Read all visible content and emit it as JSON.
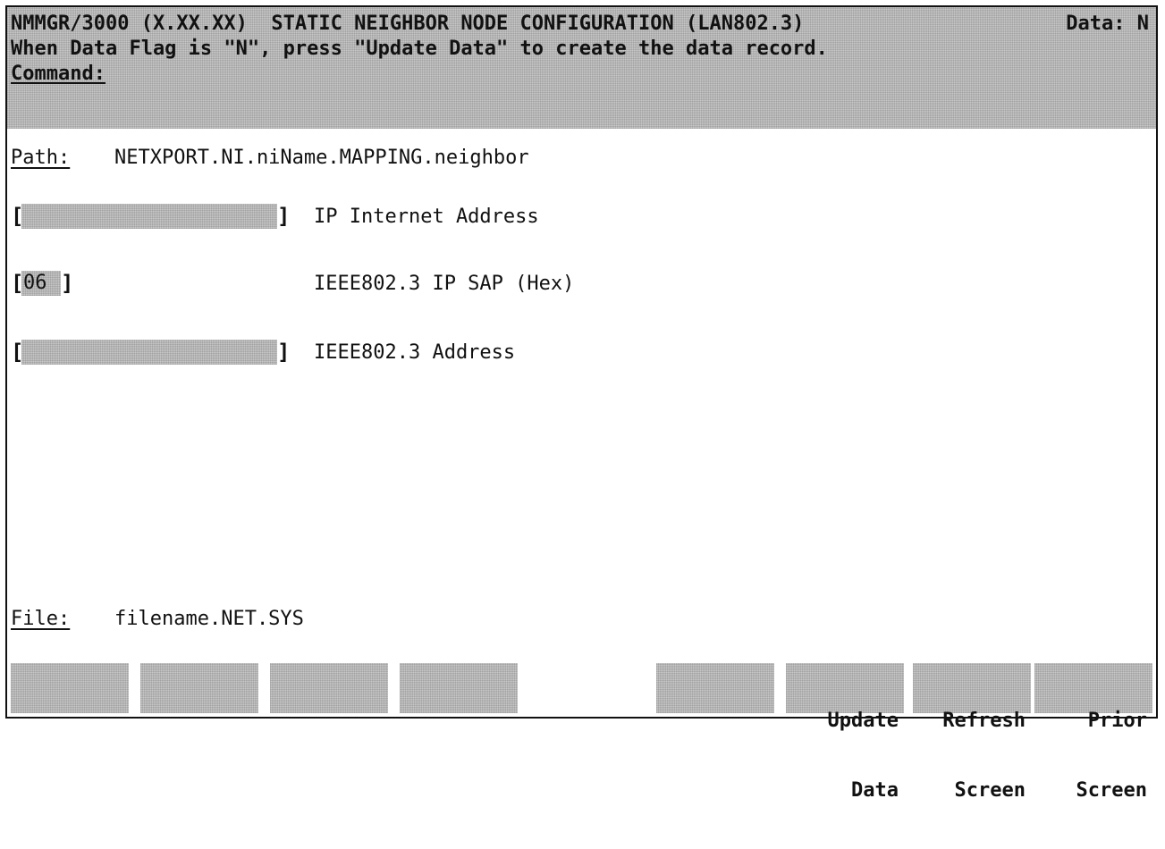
{
  "header": {
    "line1": "NMMGR/3000 (X.XX.XX)  STATIC NEIGHBOR NODE CONFIGURATION (LAN802.3)",
    "data_flag": "Data: N",
    "line2": "When Data Flag is \"N\", press \"Update Data\" to create the data record.",
    "command_label": "Command:"
  },
  "path": {
    "label": "Path:",
    "value": "NETXPORT.NI.niName.MAPPING.neighbor"
  },
  "fields": [
    {
      "value": "",
      "label": "IP Internet Address"
    },
    {
      "value": "06",
      "label": "IEEE802.3 IP SAP (Hex)"
    },
    {
      "value": "",
      "label": "IEEE802.3 Address"
    }
  ],
  "file": {
    "label": "File:",
    "value": "filename.NET.SYS"
  },
  "softkeys": [
    {
      "line1": "",
      "line2": ""
    },
    {
      "line1": "",
      "line2": ""
    },
    {
      "line1": "",
      "line2": ""
    },
    {
      "line1": "",
      "line2": ""
    },
    {
      "line1": "",
      "line2": ""
    },
    {
      "line1": "Update",
      "line2": "Data"
    },
    {
      "line1": "Refresh",
      "line2": "Screen"
    },
    {
      "line1": "Prior",
      "line2": "Screen"
    }
  ]
}
